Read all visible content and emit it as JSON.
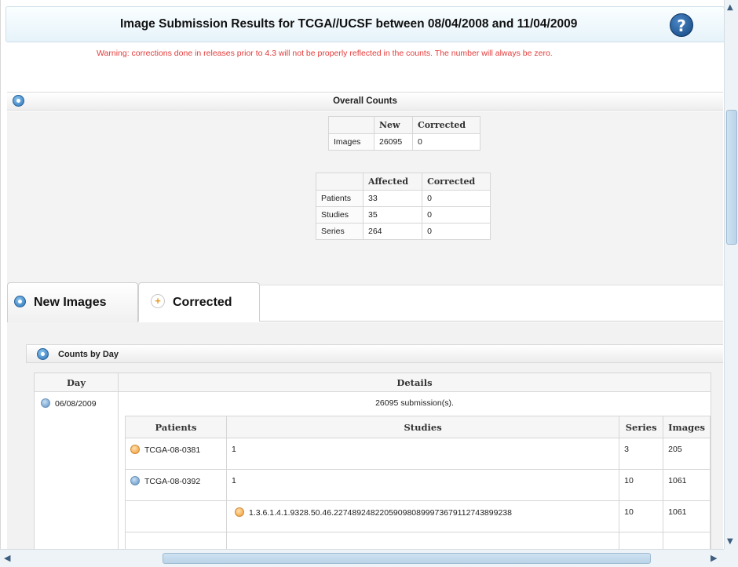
{
  "header": {
    "title": "Image Submission Results for TCGA//UCSF between 08/04/2008 and 11/04/2009",
    "help_icon": "?",
    "warning": "Warning: corrections done in releases prior to 4.3 will not be properly reflected in the counts. The number will always be zero."
  },
  "overall": {
    "title": "Overall Counts",
    "images_table": {
      "headers": [
        "",
        "New",
        "Corrected"
      ],
      "rows": [
        [
          "Images",
          "26095",
          "0"
        ]
      ]
    },
    "affected_table": {
      "headers": [
        "",
        "Affected",
        "Corrected"
      ],
      "rows": [
        [
          "Patients",
          "33",
          "0"
        ],
        [
          "Studies",
          "35",
          "0"
        ],
        [
          "Series",
          "264",
          "0"
        ]
      ]
    }
  },
  "tabs": [
    {
      "label": "New Images",
      "icon": "collapse-circle-icon"
    },
    {
      "label": "Corrected",
      "icon": "plus-icon"
    }
  ],
  "counts_by_day": {
    "title": "Counts by Day",
    "headers": {
      "day": "Day",
      "details": "Details"
    },
    "day": "06/08/2009",
    "summary": "26095 submission(s).",
    "inner_headers": {
      "patients": "Patients",
      "studies": "Studies",
      "series": "Series",
      "images": "Images"
    },
    "rows": [
      {
        "patient": "TCGA-08-0381",
        "studies": "1",
        "series": "3",
        "images": "205"
      },
      {
        "patient": "TCGA-08-0392",
        "studies": "1",
        "series": "10",
        "images": "1061"
      },
      {
        "patient": "",
        "studies": "1.3.6.1.4.1.9328.50.46.227489248220590980899973679112743899238",
        "series": "10",
        "images": "1061"
      }
    ]
  },
  "colors": {
    "warning": "#e53a3a",
    "accent_blue": "#2a72b8",
    "panel_bg": "#f3f3f3"
  }
}
